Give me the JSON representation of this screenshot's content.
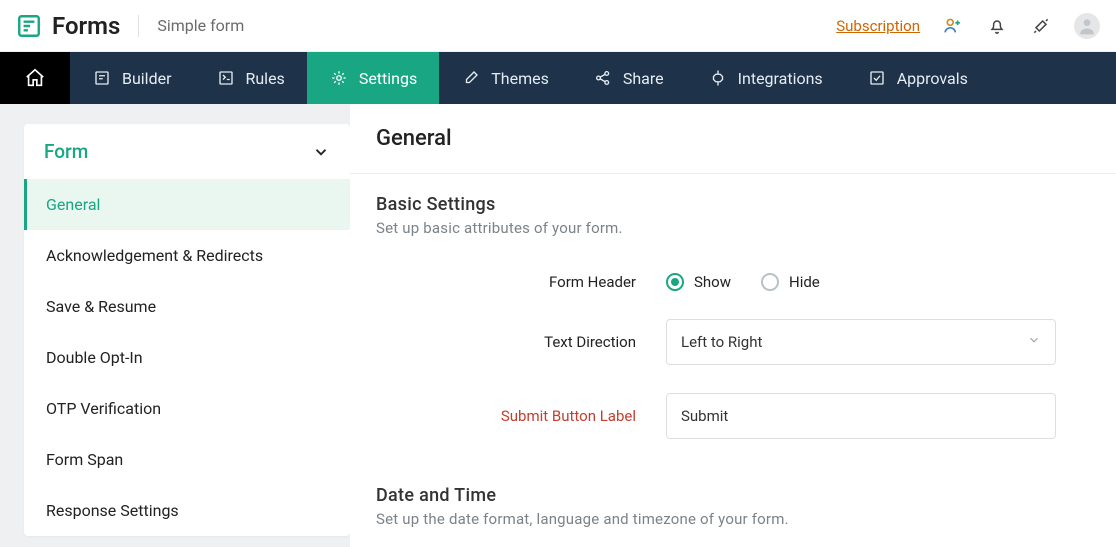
{
  "brand": {
    "name": "Forms",
    "form_title": "Simple form",
    "subscription_label": "Subscription"
  },
  "nav": {
    "items": [
      {
        "label": "Builder"
      },
      {
        "label": "Rules"
      },
      {
        "label": "Settings"
      },
      {
        "label": "Themes"
      },
      {
        "label": "Share"
      },
      {
        "label": "Integrations"
      },
      {
        "label": "Approvals"
      }
    ]
  },
  "sidebar": {
    "group_title": "Form",
    "items": [
      {
        "label": "General"
      },
      {
        "label": "Acknowledgement & Redirects"
      },
      {
        "label": "Save & Resume"
      },
      {
        "label": "Double Opt-In"
      },
      {
        "label": "OTP Verification"
      },
      {
        "label": "Form Span"
      },
      {
        "label": "Response Settings"
      }
    ]
  },
  "page": {
    "title": "General",
    "basic": {
      "title": "Basic Settings",
      "subtitle": "Set up basic attributes of your form.",
      "form_header_label": "Form Header",
      "show_label": "Show",
      "hide_label": "Hide",
      "text_direction_label": "Text Direction",
      "text_direction_value": "Left to Right",
      "submit_button_label_label": "Submit Button Label",
      "submit_button_label_value": "Submit"
    },
    "datetime": {
      "title": "Date and Time",
      "subtitle": "Set up the date format, language and timezone of your form."
    }
  }
}
